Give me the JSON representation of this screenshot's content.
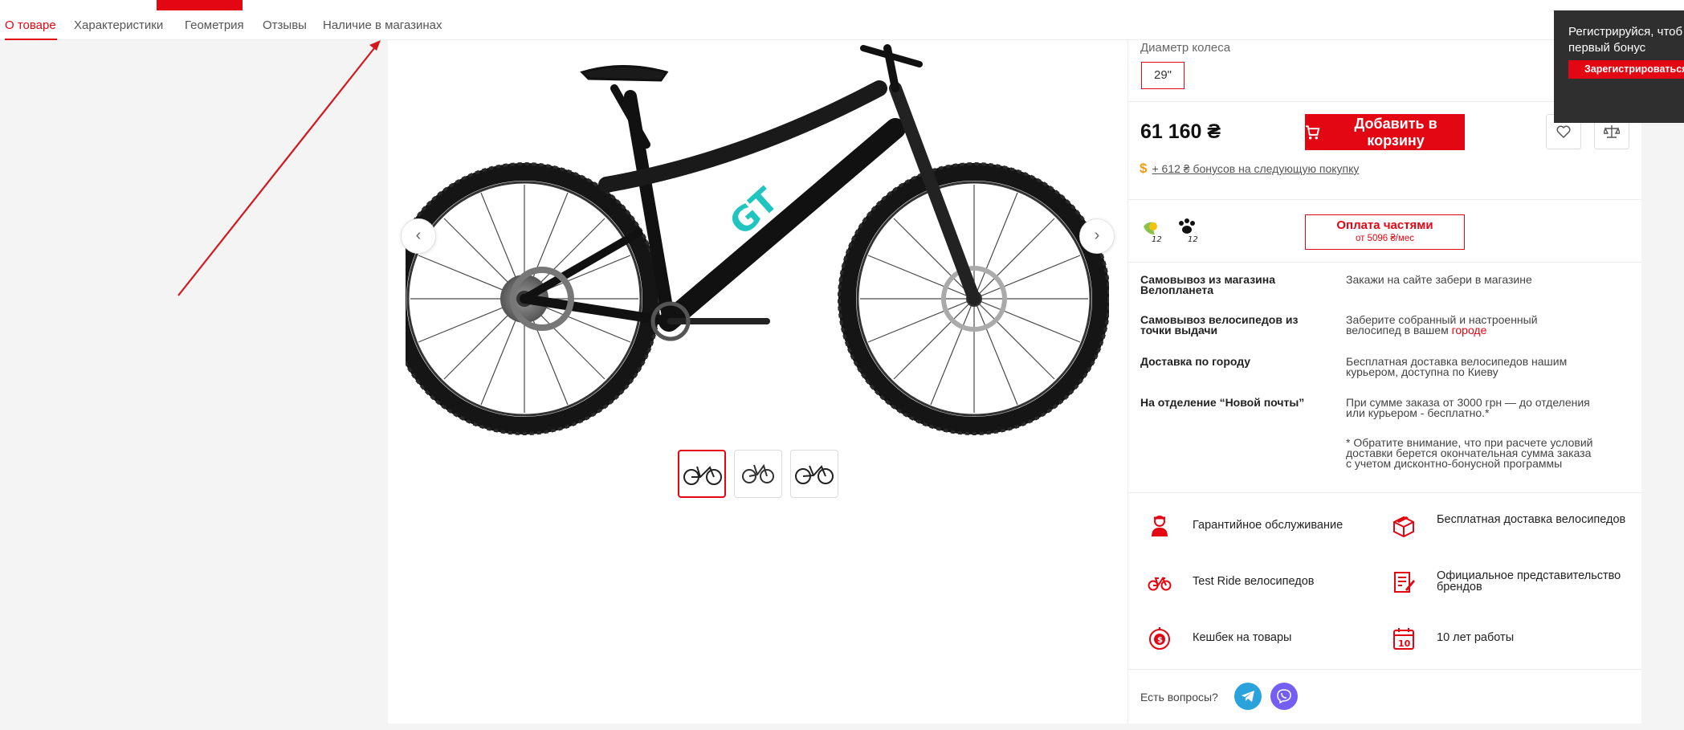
{
  "tabs": [
    {
      "label": "О товаре",
      "active": true
    },
    {
      "label": "Характеристики"
    },
    {
      "label": "Геометрия"
    },
    {
      "label": "Отзывы"
    },
    {
      "label": "Наличие в магазинах"
    }
  ],
  "gallery": {
    "prev_icon": "‹",
    "next_icon": "›",
    "thumbnail_count": 3,
    "active_thumbnail": 1
  },
  "product": {
    "wheel_label": "Диаметр колеса",
    "wheel_value": "29\"",
    "price": "61 160 ₴",
    "add_to_cart": "Добавить в корзину",
    "bonus_symbol": "$",
    "bonus_text": "+ 612 ₴ бонусов на следующую покупку",
    "installments_count_1": "12",
    "installments_count_2": "12",
    "pay_parts_title": "Оплата частями",
    "pay_parts_sub": "от 5096 ₴/мес"
  },
  "delivery": [
    {
      "title": "Самовывоз из магазина Велопланета",
      "text": "Закажи на сайте забери в магазине"
    },
    {
      "title": "Самовывоз велосипедов из точки выдачи",
      "text": "Заберите собранный и настроенный велосипед в вашем ",
      "link": "городе"
    },
    {
      "title": "Доставка по городу",
      "text": "Бесплатная доставка велосипедов нашим курьером, доступна по Киеву"
    },
    {
      "title": "На отделение “Новой почты”",
      "text": "При сумме заказа от 3000 грн — до отделения или курьером - бесплатно.*"
    }
  ],
  "delivery_note": "* Обратите внимание, что при расчете условий доставки берется окончательная сумма заказа с учетом дисконтно-бонусной программы",
  "advantages": [
    {
      "icon": "mechanic-icon",
      "label": "Гарантийное обслуживание"
    },
    {
      "icon": "delivery-box-icon",
      "label": "Бесплатная доставка велосипедов"
    },
    {
      "icon": "bicycle-icon",
      "label": "Test Ride велосипедов"
    },
    {
      "icon": "certificate-icon",
      "label": "Официальное представительство брендов"
    },
    {
      "icon": "cashback-icon",
      "label": "Кешбек на товары"
    },
    {
      "icon": "calendar-icon",
      "label": "10 лет работы"
    }
  ],
  "calendar_number": "10",
  "questions": "Есть вопросы?",
  "popup": {
    "line1": "Регистрируйся, чтоб",
    "line2": "первый бонус",
    "button": "Зарегистрироваться"
  },
  "colors": {
    "accent": "#e30613",
    "telegram": "#2aa3dd",
    "viber": "#7360f2",
    "popup_bg": "#2f2f2f"
  }
}
